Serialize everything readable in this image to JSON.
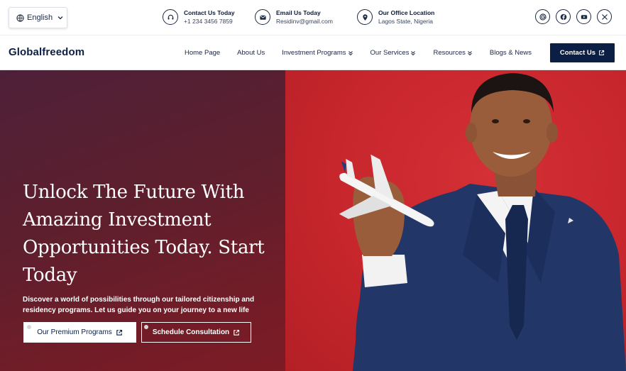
{
  "language": {
    "label": "English",
    "icon": "globe-icon"
  },
  "contacts": [
    {
      "title": "Contact Us Today",
      "value": "+1 234 3456 7859",
      "icon": "headset-icon"
    },
    {
      "title": "Email Us Today",
      "value": "Residinv@gmail.com",
      "icon": "mail-icon"
    },
    {
      "title": "Our Office Location",
      "value": "Lagos State, Nigeria",
      "icon": "location-pin-icon"
    }
  ],
  "socials": [
    "threads-icon",
    "facebook-icon",
    "youtube-icon",
    "x-icon"
  ],
  "brand": {
    "logo_text": "Globalfreedom",
    "color": "#0b1f45"
  },
  "nav": {
    "items": [
      {
        "label": "Home Page",
        "dropdown": false
      },
      {
        "label": "About Us",
        "dropdown": false
      },
      {
        "label": "Investment Programs",
        "dropdown": true
      },
      {
        "label": "Our Services",
        "dropdown": true
      },
      {
        "label": "Resources",
        "dropdown": true
      },
      {
        "label": "Blogs & News",
        "dropdown": false
      }
    ],
    "cta_label": "Contact Us"
  },
  "hero": {
    "headline": "Unlock The Future With Amazing Investment Opportunities Today. Start Today",
    "subtext": "Discover a world of possibilities through our tailored citizenship and residency programs. Let us guide you on your journey to a new life",
    "primary_button": "Our Premium Programs",
    "secondary_button": "Schedule Consultation",
    "left_color": "#5e1f2d",
    "right_color": "#c6262c"
  }
}
